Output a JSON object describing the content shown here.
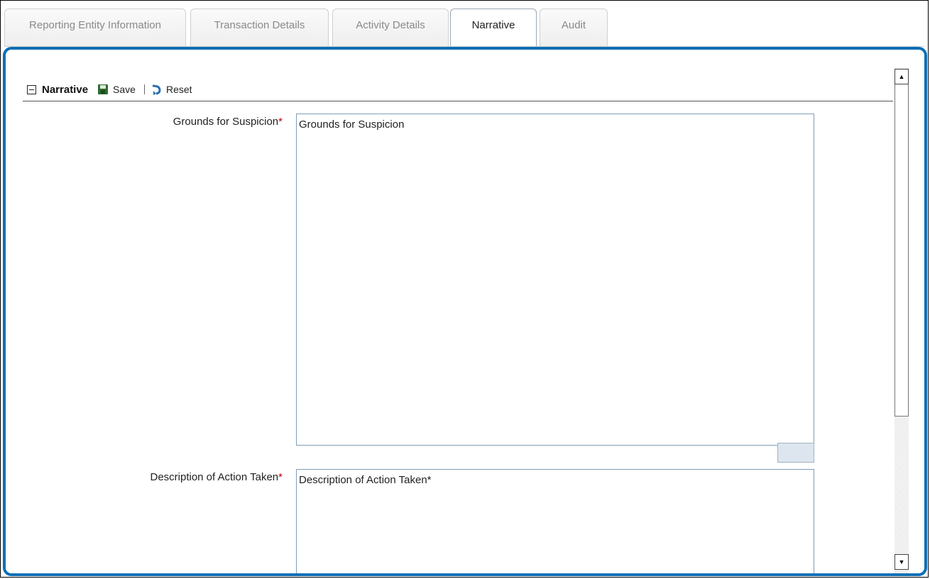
{
  "tabs": [
    {
      "label": "Reporting Entity Information",
      "active": false
    },
    {
      "label": "Transaction Details",
      "active": false
    },
    {
      "label": "Activity Details",
      "active": false
    },
    {
      "label": "Narrative",
      "active": true
    },
    {
      "label": "Audit",
      "active": false
    }
  ],
  "toolbar": {
    "section_title": "Narrative",
    "save_label": "Save",
    "reset_label": "Reset"
  },
  "fields": {
    "grounds": {
      "label": "Grounds for Suspicion",
      "required_marker": "*",
      "value": "Grounds for Suspicion"
    },
    "description": {
      "label": "Description of Action Taken",
      "required_marker": "*",
      "value": "Description of Action Taken*"
    }
  },
  "colors": {
    "panel_border": "#0d6fb4",
    "required": "#c00000"
  },
  "icons": {
    "collapse": "minus-box-icon",
    "save": "floppy-disk-icon",
    "reset": "curved-arrow-icon",
    "scroll_up": "triangle-up-icon",
    "scroll_down": "triangle-down-icon"
  }
}
